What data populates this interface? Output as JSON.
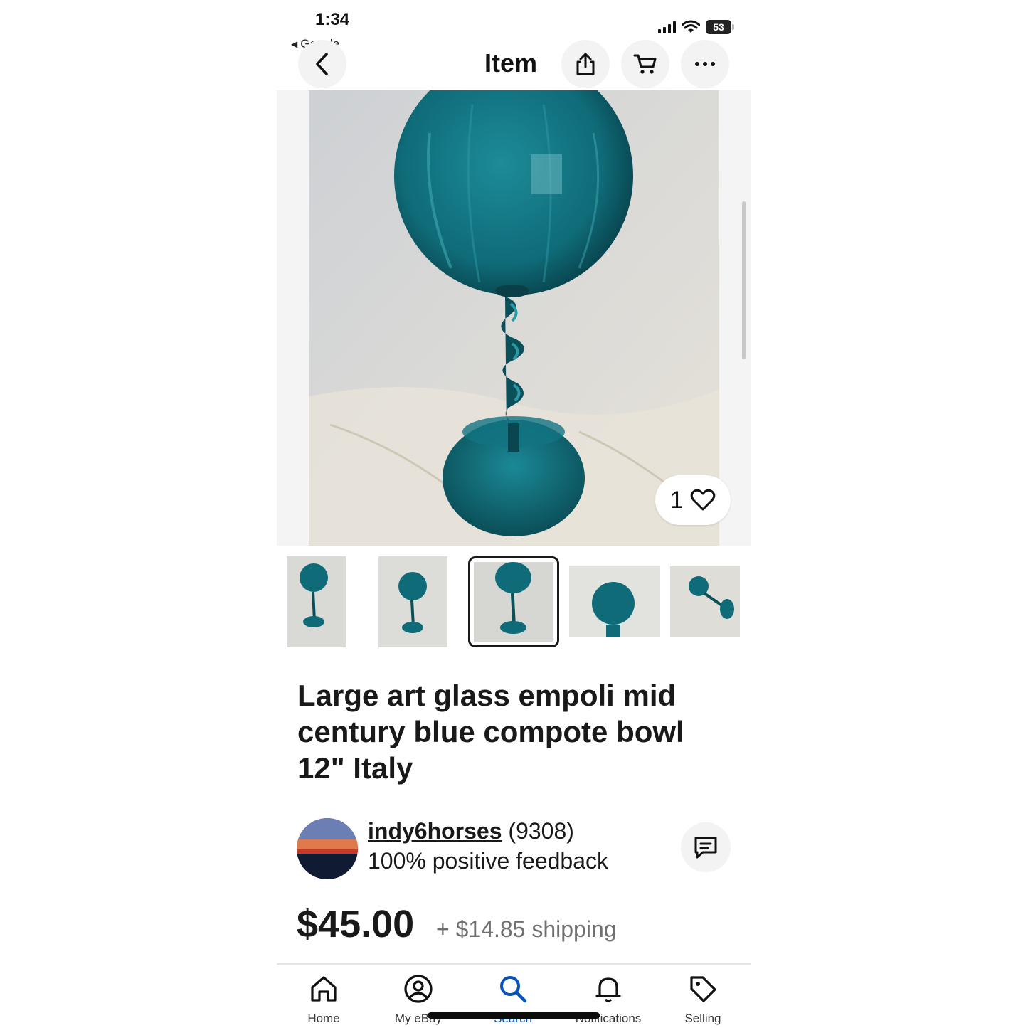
{
  "status_bar": {
    "time": "1:34",
    "back_app": "Google",
    "battery": "53"
  },
  "nav": {
    "title": "Item",
    "icons": [
      "back-chevron-icon",
      "share-icon",
      "cart-icon",
      "more-icon"
    ]
  },
  "gallery": {
    "watch_count": "1",
    "thumbnail_count": 5,
    "selected_thumbnail": 3
  },
  "item": {
    "title": "Large art glass empoli mid century blue compote bowl 12\" Italy"
  },
  "seller": {
    "name": "indy6horses",
    "score": "(9308)",
    "feedback": "100% positive feedback"
  },
  "pricing": {
    "price": "$45.00",
    "shipping": "+ $14.85 shipping"
  },
  "tabbar": {
    "tabs": [
      {
        "label": "Home",
        "icon": "home-icon"
      },
      {
        "label": "My eBay",
        "icon": "account-icon"
      },
      {
        "label": "Search",
        "icon": "search-icon",
        "active": true
      },
      {
        "label": "Notifications",
        "icon": "bell-icon"
      },
      {
        "label": "Selling",
        "icon": "tag-icon"
      }
    ]
  },
  "colors": {
    "glass": "#0f6b78",
    "active_tab": "#0654ba",
    "text": "#191919"
  }
}
